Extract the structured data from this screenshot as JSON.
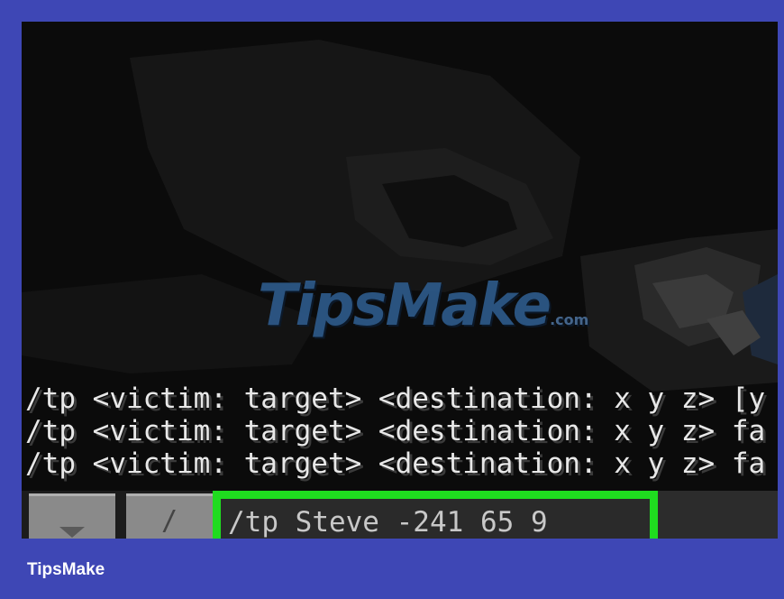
{
  "chat": {
    "lines": [
      "/tp <victim: target> <destination: x y z> [y",
      "/tp <victim: target> <destination: x y z> fa",
      "/tp <victim: target> <destination: x y z> fa"
    ]
  },
  "toolbar": {
    "menu_icon": "chevron-down-icon",
    "slash_label": "/",
    "command_value": "/tp Steve -241 65 9"
  },
  "watermark": {
    "text": "TipsMake",
    "suffix": ".com"
  },
  "footer": {
    "brand": "TipsMake"
  },
  "colors": {
    "frame": "#3e47b5",
    "highlight": "#1fdc1f",
    "chat_text": "#e8e8e8"
  }
}
